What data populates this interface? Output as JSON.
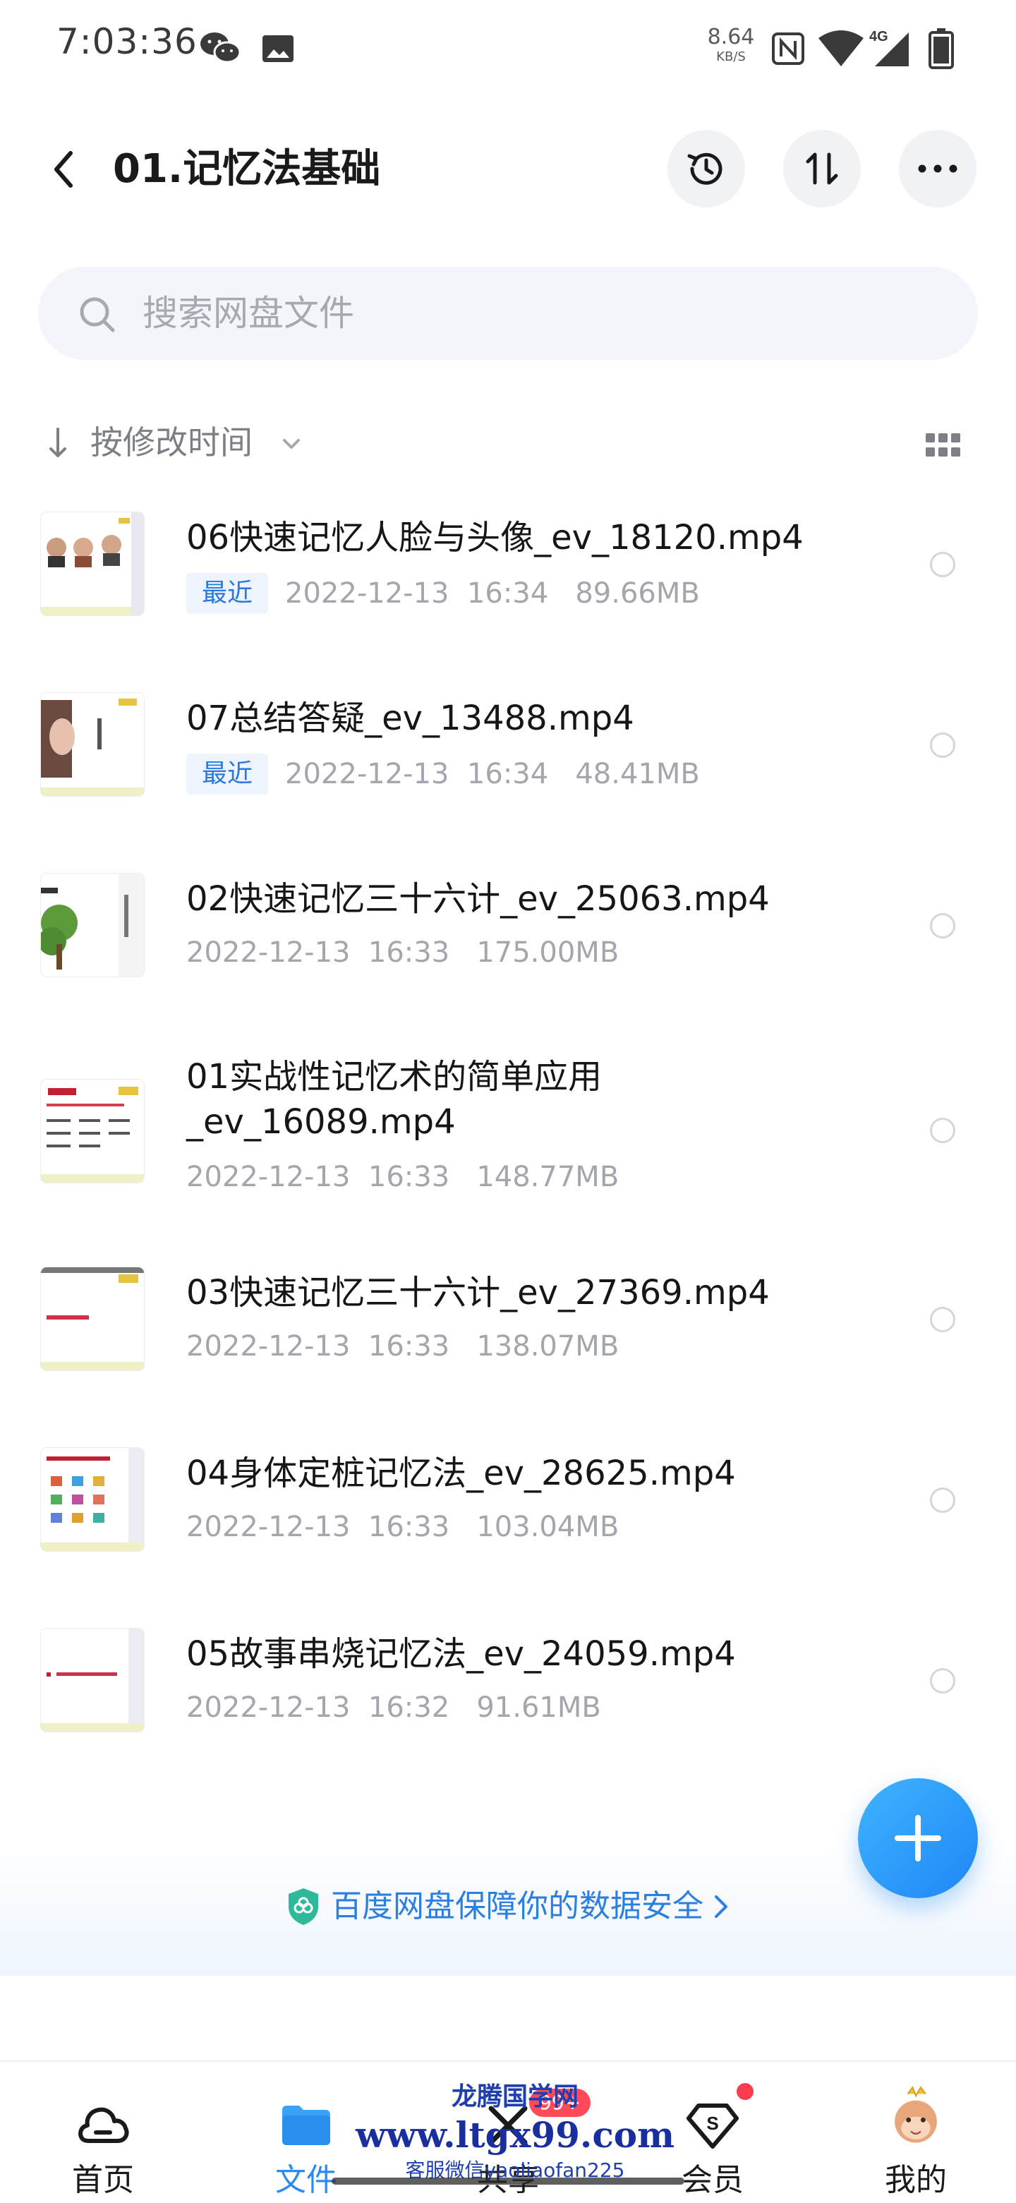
{
  "status_bar": {
    "time": "7:03:36",
    "net_speed_value": "8.64",
    "net_speed_unit": "KB/S",
    "icons": [
      "wechat-icon",
      "image-icon",
      "nfc-icon",
      "wifi-icon",
      "signal-4g-icon",
      "battery-icon"
    ],
    "network_type": "4G"
  },
  "header": {
    "title": "01.记忆法基础",
    "back_icon": "chevron-left-icon",
    "history_icon": "history-icon",
    "sort_icon": "sort-icon",
    "more_icon": "more-icon"
  },
  "search": {
    "placeholder": "搜索网盘文件"
  },
  "sort": {
    "label": "按修改时间"
  },
  "files": [
    {
      "name": "06快速记忆人脸与头像_ev_18120.mp4",
      "recent": "最近",
      "date": "2022-12-13",
      "time": "16:34",
      "size": "89.66MB"
    },
    {
      "name": "07总结答疑_ev_13488.mp4",
      "recent": "最近",
      "date": "2022-12-13",
      "time": "16:34",
      "size": "48.41MB"
    },
    {
      "name": "02快速记忆三十六计_ev_25063.mp4",
      "date": "2022-12-13",
      "time": "16:33",
      "size": "175.00MB"
    },
    {
      "name_line1": "01实战性记忆术的简单应用",
      "name_line2": "_ev_16089.mp4",
      "date": "2022-12-13",
      "time": "16:33",
      "size": "148.77MB"
    },
    {
      "name": "03快速记忆三十六计_ev_27369.mp4",
      "date": "2022-12-13",
      "time": "16:33",
      "size": "138.07MB"
    },
    {
      "name": "04身体定桩记忆法_ev_28625.mp4",
      "date": "2022-12-13",
      "time": "16:33",
      "size": "103.04MB"
    },
    {
      "name": "05故事串烧记忆法_ev_24059.mp4",
      "date": "2022-12-13",
      "time": "16:32",
      "size": "91.61MB"
    }
  ],
  "security_banner": {
    "text": "百度网盘保障你的数据安全"
  },
  "fab": {
    "icon": "plus-icon"
  },
  "bottom_nav": {
    "items": [
      {
        "label": "首页",
        "icon": "cloud-home-icon"
      },
      {
        "label": "文件",
        "icon": "folder-icon",
        "active": true
      },
      {
        "label": "共享",
        "icon": "share-icon",
        "badge": "99+"
      },
      {
        "label": "会员",
        "icon": "vip-diamond-icon"
      },
      {
        "label": "我的",
        "icon": "avatar-icon"
      }
    ]
  },
  "watermark": {
    "line1": "龙腾国学网",
    "line2": "www.ltgx99.com",
    "line3": "客服微信yaoliaofan225"
  },
  "colors": {
    "accent": "#2a8cf0",
    "badge_red": "#ff4a5a",
    "recent_text": "#2a78e0",
    "meta_gray": "#a3a6ad"
  }
}
